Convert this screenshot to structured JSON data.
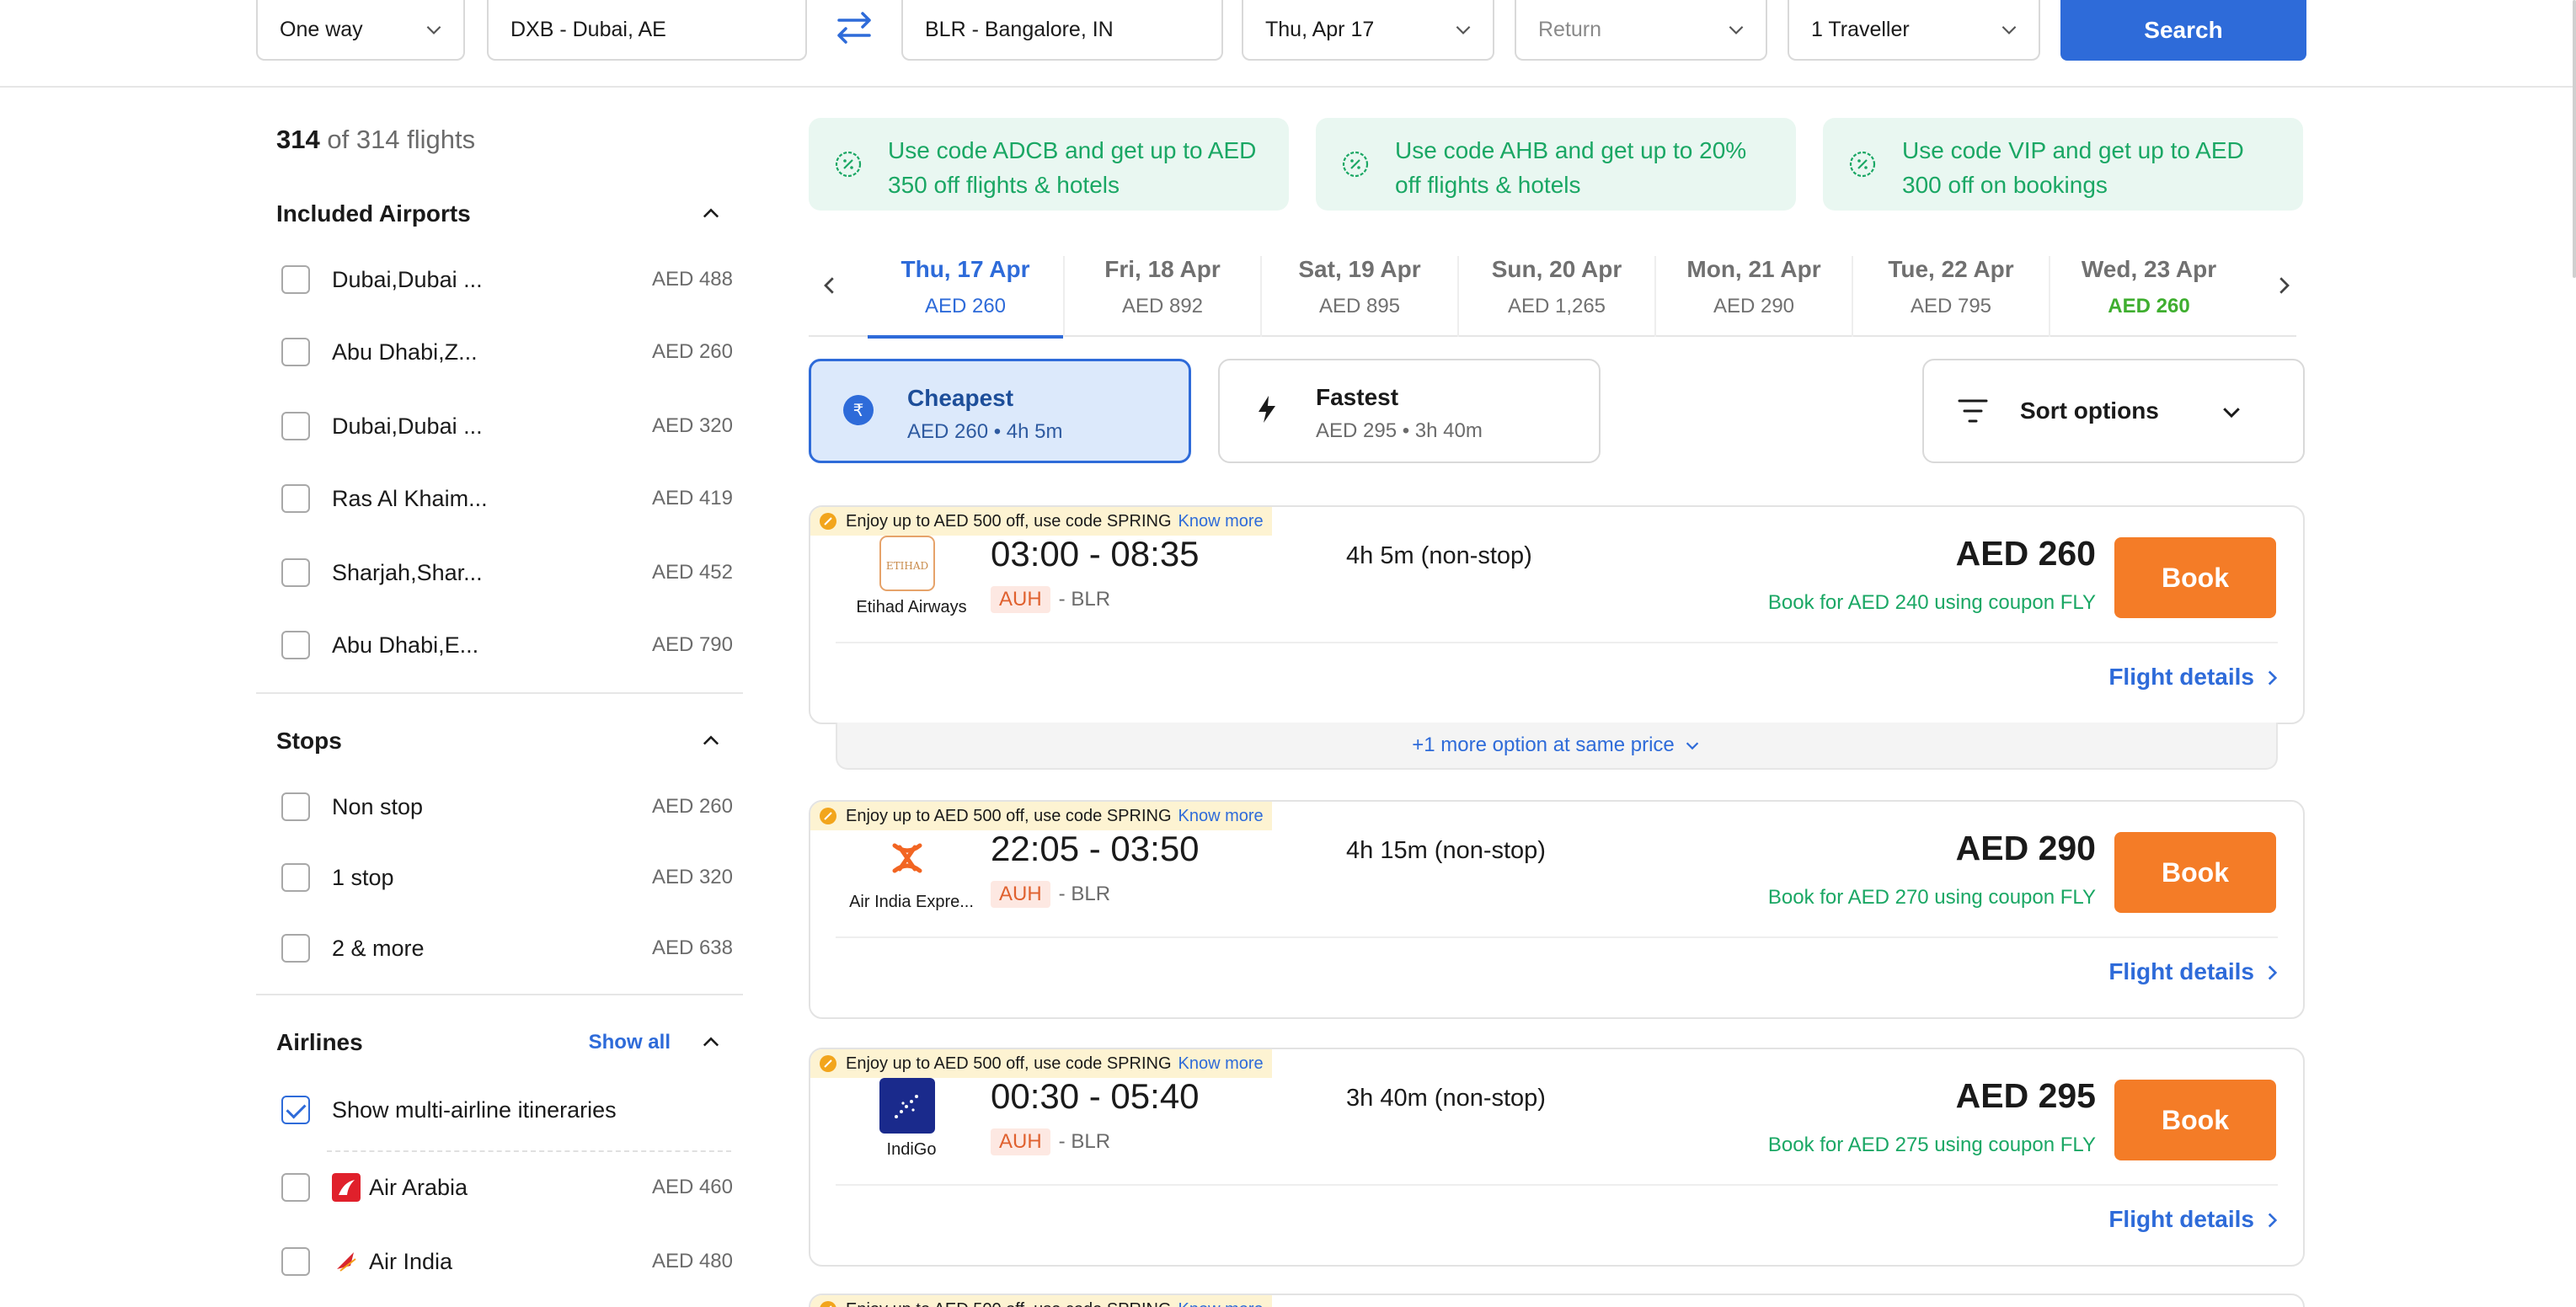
{
  "search": {
    "trip_type": "One way",
    "origin": "DXB - Dubai, AE",
    "destination": "BLR - Bangalore, IN",
    "depart_date": "Thu, Apr 17",
    "return_placeholder": "Return",
    "travellers": "1 Traveller",
    "search_label": "Search"
  },
  "results": {
    "shown": "314",
    "total_text": "of 314 flights"
  },
  "filters": {
    "airports": {
      "title": "Included Airports",
      "items": [
        {
          "label": "Dubai,Dubai ...",
          "price": "AED 488"
        },
        {
          "label": "Abu Dhabi,Z...",
          "price": "AED 260"
        },
        {
          "label": "Dubai,Dubai ...",
          "price": "AED 320"
        },
        {
          "label": "Ras Al Khaim...",
          "price": "AED 419"
        },
        {
          "label": "Sharjah,Shar...",
          "price": "AED 452"
        },
        {
          "label": "Abu Dhabi,E...",
          "price": "AED 790"
        }
      ]
    },
    "stops": {
      "title": "Stops",
      "items": [
        {
          "label": "Non stop",
          "price": "AED 260"
        },
        {
          "label": "1 stop",
          "price": "AED 320"
        },
        {
          "label": "2 & more",
          "price": "AED 638"
        }
      ]
    },
    "airlines": {
      "title": "Airlines",
      "show_all": "Show all",
      "multi_airline": "Show multi-airline itineraries",
      "items": [
        {
          "label": "Air Arabia",
          "price": "AED 460"
        },
        {
          "label": "Air India",
          "price": "AED 480"
        }
      ]
    }
  },
  "promos": [
    {
      "text": "Use code ADCB and get up to AED 350 off flights & hotels"
    },
    {
      "text": "Use code AHB and get up to 20% off flights & hotels"
    },
    {
      "text": "Use code VIP and get up to AED 300 off on bookings"
    }
  ],
  "dates": [
    {
      "day": "Thu, 17 Apr",
      "price": "AED 260"
    },
    {
      "day": "Fri, 18 Apr",
      "price": "AED 892"
    },
    {
      "day": "Sat, 19 Apr",
      "price": "AED 895"
    },
    {
      "day": "Sun, 20 Apr",
      "price": "AED 1,265"
    },
    {
      "day": "Mon, 21 Apr",
      "price": "AED 290"
    },
    {
      "day": "Tue, 22 Apr",
      "price": "AED 795"
    },
    {
      "day": "Wed, 23 Apr",
      "price": "AED 260"
    }
  ],
  "sort": {
    "cheapest": {
      "title": "Cheapest",
      "sub": "AED 260 • 4h 5m"
    },
    "fastest": {
      "title": "Fastest",
      "sub": "AED 295 • 3h 40m"
    },
    "options": "Sort options"
  },
  "offer": {
    "text": "Enjoy up to AED 500 off, use code SPRING",
    "link": "Know more"
  },
  "flights": [
    {
      "airline": "Etihad Airways",
      "times": "03:00 - 08:35",
      "from": "AUH",
      "to": "- BLR",
      "duration": "4h 5m (non-stop)",
      "price": "AED 260",
      "coupon": "Book for AED 240 using coupon FLY",
      "book": "Book",
      "details": "Flight details"
    },
    {
      "airline": "Air India Expre...",
      "times": "22:05 - 03:50",
      "from": "AUH",
      "to": "- BLR",
      "duration": "4h 15m (non-stop)",
      "price": "AED 290",
      "coupon": "Book for AED 270 using coupon FLY",
      "book": "Book",
      "details": "Flight details"
    },
    {
      "airline": "IndiGo",
      "times": "00:30 - 05:40",
      "from": "AUH",
      "to": "- BLR",
      "duration": "3h 40m (non-stop)",
      "price": "AED 295",
      "coupon": "Book for AED 275 using coupon FLY",
      "book": "Book",
      "details": "Flight details"
    }
  ],
  "more_option": "+1 more option at same price",
  "icons": {
    "swap": "swap-arrows-icon",
    "chevron": "chevron-down-icon",
    "promo": "discount-badge-icon",
    "cheapest": "rupee-coin-icon",
    "fastest": "lightning-icon",
    "sort": "sort-lines-icon"
  },
  "colors": {
    "primary": "#2e6bd9",
    "book": "#f47c27",
    "promo_text": "#1aa764",
    "promo_bg": "#e9f7f1",
    "offer_bg": "#fdf3d2"
  }
}
